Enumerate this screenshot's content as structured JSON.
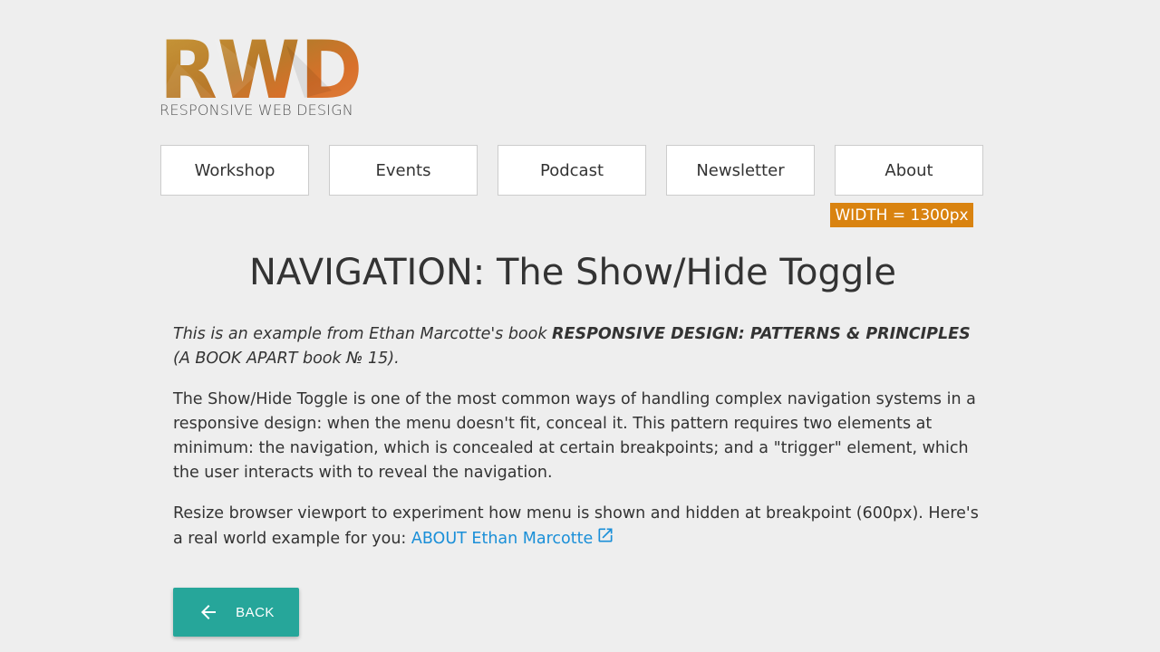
{
  "logo": {
    "letters": "RWD",
    "subtitle": "RESPONSIVE WEB DESIGN"
  },
  "nav": {
    "items": [
      {
        "label": "Workshop"
      },
      {
        "label": "Events"
      },
      {
        "label": "Podcast"
      },
      {
        "label": "Newsletter"
      },
      {
        "label": "About"
      }
    ]
  },
  "badge": {
    "text": "WIDTH = 1300px",
    "color": "#d98310"
  },
  "main": {
    "title": "NAVIGATION: The Show/Hide Toggle",
    "intro": {
      "prefix": "This is an example from Ethan Marcotte's book ",
      "book_title": "RESPONSIVE DESIGN: PATTERNS & PRINCIPLES",
      "suffix": " (A BOOK APART book № 15)."
    },
    "paragraph1": "The Show/Hide Toggle is one of the most common ways of handling complex navigation systems in a responsive design: when the menu doesn't fit, conceal it. This pattern requires two elements at minimum: the navigation, which is concealed at certain breakpoints; and a \"trigger\" element, which the user interacts with to reveal the navigation.",
    "paragraph2_text": "Resize browser viewport to experiment how menu is shown and hidden at breakpoint (600px). Here's a real world example for you: ",
    "link_label": "ABOUT Ethan Marcotte",
    "link_icon": "external-link-icon"
  },
  "back_button": {
    "label": "BACK",
    "icon": "arrow-left-icon",
    "color": "#26a69a"
  }
}
